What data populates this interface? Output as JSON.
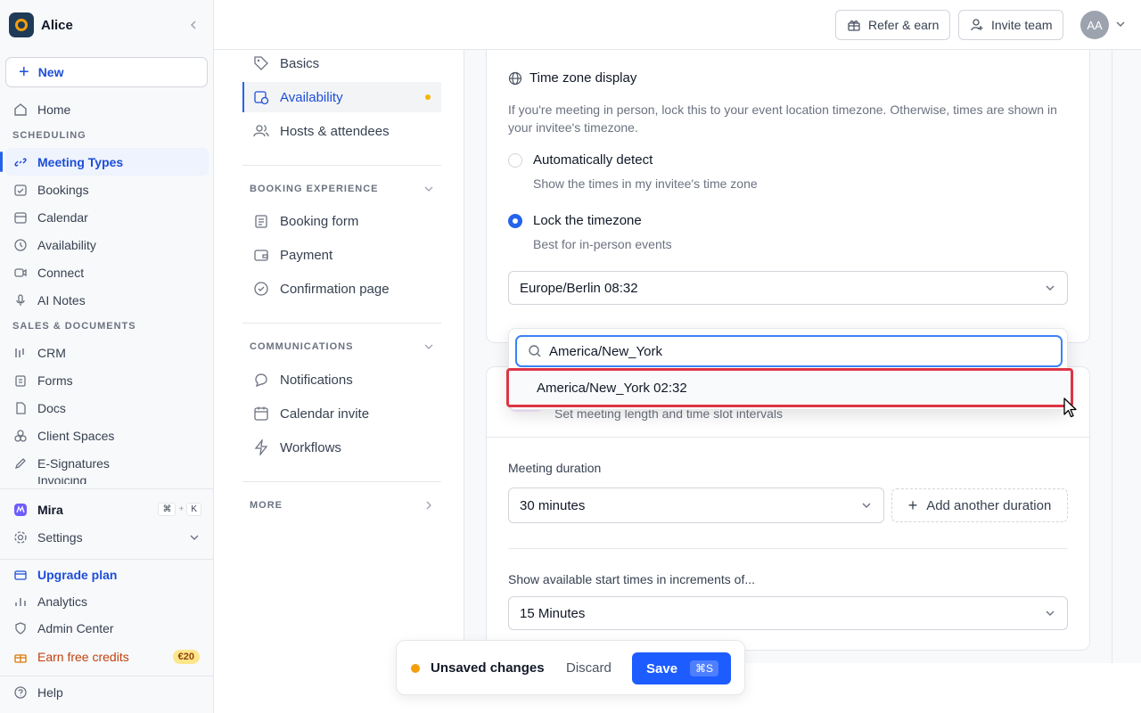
{
  "workspace": {
    "name": "Alice"
  },
  "sidebar": {
    "new_label": "New",
    "home": "Home",
    "scheduling_label": "SCHEDULING",
    "scheduling": [
      {
        "label": "Meeting Types",
        "icon": "link-icon",
        "active": true
      },
      {
        "label": "Bookings",
        "icon": "calendar-check-icon"
      },
      {
        "label": "Calendar",
        "icon": "calendar-icon"
      },
      {
        "label": "Availability",
        "icon": "clock-icon"
      },
      {
        "label": "Connect",
        "icon": "video-icon"
      },
      {
        "label": "AI Notes",
        "icon": "microphone-icon"
      }
    ],
    "sales_label": "SALES & DOCUMENTS",
    "sales": [
      {
        "label": "CRM",
        "icon": "crm-icon"
      },
      {
        "label": "Forms",
        "icon": "clipboard-icon"
      },
      {
        "label": "Docs",
        "icon": "document-icon"
      },
      {
        "label": "Client Spaces",
        "icon": "cubes-icon"
      },
      {
        "label": "E-Signatures",
        "icon": "pen-icon"
      },
      {
        "label": "Invoicing",
        "icon": "invoice-icon"
      }
    ],
    "mira": "Mira",
    "mira_kbd_1": "⌘",
    "mira_kbd_plus": "+",
    "mira_kbd_2": "K",
    "settings": "Settings",
    "upgrade": "Upgrade plan",
    "analytics": "Analytics",
    "admin": "Admin Center",
    "credits": "Earn free credits",
    "credits_badge": "€20",
    "help": "Help"
  },
  "topbar": {
    "refer": "Refer & earn",
    "invite": "Invite team",
    "avatar_initials": "AA"
  },
  "subnav": {
    "items_top": [
      {
        "label": "Basics",
        "icon": "tag-icon"
      },
      {
        "label": "Availability",
        "icon": "calendar-clock-icon",
        "active": true
      },
      {
        "label": "Hosts & attendees",
        "icon": "users-icon"
      }
    ],
    "booking_section": "BOOKING EXPERIENCE",
    "booking_items": [
      {
        "label": "Booking form",
        "icon": "clipboard-icon"
      },
      {
        "label": "Payment",
        "icon": "wallet-icon"
      },
      {
        "label": "Confirmation page",
        "icon": "check-circle-icon"
      }
    ],
    "comm_section": "COMMUNICATIONS",
    "comm_items": [
      {
        "label": "Notifications",
        "icon": "chat-bubble-icon"
      },
      {
        "label": "Calendar invite",
        "icon": "calendar-icon"
      },
      {
        "label": "Workflows",
        "icon": "bolt-icon"
      }
    ],
    "more_section": "MORE"
  },
  "timezone": {
    "title": "Time zone display",
    "description": "If you're meeting in person, lock this to your event location timezone. Otherwise, times are shown in your invitee's timezone.",
    "options": [
      {
        "title": "Automatically detect",
        "sub": "Show the times in my invitee's time zone",
        "selected": false
      },
      {
        "title": "Lock the timezone",
        "sub": "Best for in-person events",
        "selected": true
      }
    ],
    "selected_value": "Europe/Berlin 08:32",
    "search_value": "America/New_York",
    "result": "America/New_York 02:32"
  },
  "duration": {
    "subtitle": "Set meeting length and time slot intervals",
    "meeting_duration_label": "Meeting duration",
    "meeting_duration_value": "30 minutes",
    "add_duration": "Add another duration",
    "increments_label": "Show available start times in increments of...",
    "increments_value": "15 Minutes"
  },
  "unsaved_bar": {
    "message": "Unsaved changes",
    "discard": "Discard",
    "save": "Save",
    "save_kbd": "⌘S"
  }
}
